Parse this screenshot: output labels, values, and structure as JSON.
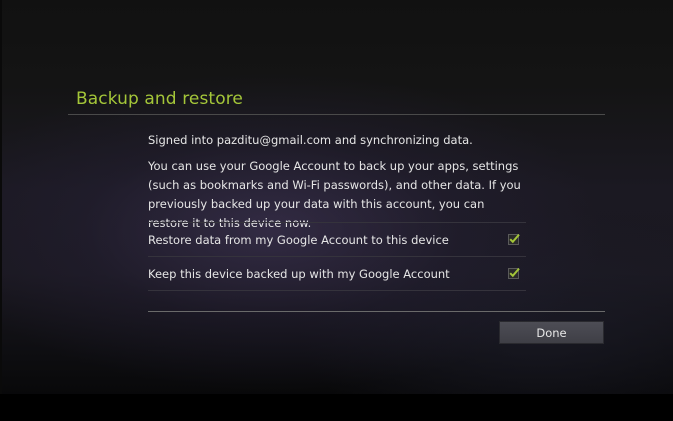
{
  "dialog": {
    "title": "Backup and restore",
    "signed_in_text": "Signed into pazditu@gmail.com and synchronizing data.",
    "description": "You can use your Google Account to back up your apps, settings (such as bookmarks and Wi-Fi passwords), and other data. If you previously backed up your data with this account, you can restore it to this device now.",
    "options": [
      {
        "label": "Restore data from my Google Account to this device",
        "checked": true
      },
      {
        "label": "Keep this device backed up with my Google Account",
        "checked": true
      }
    ],
    "done_label": "Done"
  },
  "colors": {
    "accent": "#a4c639",
    "text": "#e6e6e6",
    "background": "#1a1820"
  },
  "icons": {
    "checkbox": "checkmark-icon"
  }
}
